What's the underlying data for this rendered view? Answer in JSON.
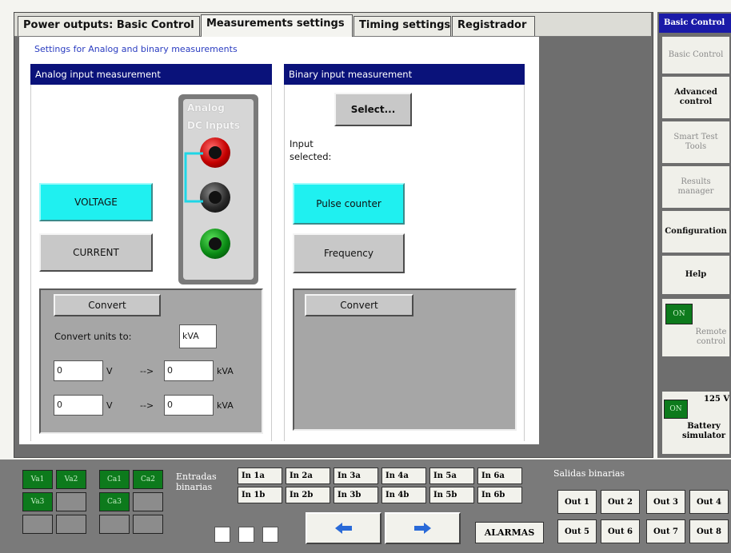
{
  "tabs": [
    {
      "label": "Power outputs: Basic Control"
    },
    {
      "label": "Measurements settings"
    },
    {
      "label": "Timing settings"
    },
    {
      "label": "Registrador"
    }
  ],
  "subtitle": "Settings for Analog and binary measurements",
  "analog": {
    "header": "Analog input measurement",
    "image_title_line1": "Analog",
    "image_title_line2": "DC Inputs",
    "voltage_label": "VOLTAGE",
    "current_label": "CURRENT",
    "convert_label": "Convert",
    "convert_units_label": "Convert units to:",
    "convert_units_value": "kVA",
    "rows": [
      {
        "in_value": "0",
        "in_unit": "V",
        "arrow": "-->",
        "out_value": "0",
        "out_unit": "kVA"
      },
      {
        "in_value": "0",
        "in_unit": "V",
        "arrow": "-->",
        "out_value": "0",
        "out_unit": "kVA"
      }
    ]
  },
  "binary": {
    "header": "Binary input measurement",
    "select_label": "Select...",
    "input_selected_label": "Input selected:",
    "pulse_counter_label": "Pulse counter",
    "frequency_label": "Frequency",
    "convert_label": "Convert"
  },
  "sidebar": {
    "header": "Basic Control",
    "items": [
      {
        "label": "Basic Control",
        "enabled": false
      },
      {
        "label": "Advanced control",
        "enabled": true
      },
      {
        "label": "Smart Test Tools",
        "enabled": false
      },
      {
        "label": "Results manager",
        "enabled": false
      },
      {
        "label": "Configuration",
        "enabled": true
      },
      {
        "label": "Help",
        "enabled": true
      }
    ],
    "remote": {
      "led": "ON",
      "label": "Remote control"
    },
    "battery": {
      "led": "ON",
      "voltage": "125 V",
      "label": "Battery simulator"
    }
  },
  "bottom": {
    "leds": [
      {
        "label": "Va1",
        "on": true
      },
      {
        "label": "Va2",
        "on": true
      },
      {
        "label": "Ca1",
        "on": true
      },
      {
        "label": "Ca2",
        "on": true
      },
      {
        "label": "Va3",
        "on": true
      },
      {
        "label": "",
        "on": false
      },
      {
        "label": "Ca3",
        "on": true
      },
      {
        "label": "",
        "on": false
      },
      {
        "label": "",
        "on": false
      },
      {
        "label": "",
        "on": false
      },
      {
        "label": "",
        "on": false
      },
      {
        "label": "",
        "on": false
      }
    ],
    "entradas_label": "Entradas binarias",
    "inputs_row1": [
      "In 1a",
      "In 2a",
      "In 3a",
      "In 4a",
      "In 5a",
      "In 6a"
    ],
    "inputs_row2": [
      "In 1b",
      "In 2b",
      "In 3b",
      "In 4b",
      "In 5b",
      "In 6b"
    ],
    "salidas_label": "Salidas binarias",
    "outputs_row1": [
      "Out 1",
      "Out 2",
      "Out 3",
      "Out 4"
    ],
    "outputs_row2": [
      "Out 5",
      "Out 6",
      "Out 7",
      "Out 8"
    ],
    "alarmas_label": "ALARMAS"
  }
}
